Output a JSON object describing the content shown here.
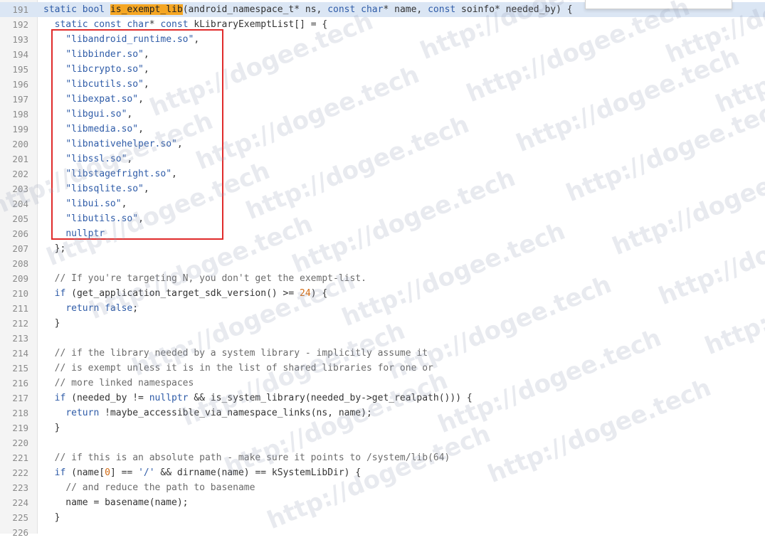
{
  "watermark": "http://dogee.tech",
  "lines": [
    {
      "n": "191",
      "t": [
        [
          "k",
          "static"
        ],
        [
          "p",
          " "
        ],
        [
          "k",
          "bool"
        ],
        [
          "p",
          " "
        ],
        [
          "hl",
          "is_exempt_lib"
        ],
        [
          "p",
          "(android_namespace_t* ns, "
        ],
        [
          "k",
          "const"
        ],
        [
          "p",
          " "
        ],
        [
          "k",
          "char"
        ],
        [
          "p",
          "* name, "
        ],
        [
          "k",
          "const"
        ],
        [
          "p",
          " soinfo* needed_by) {"
        ]
      ]
    },
    {
      "n": "192",
      "t": [
        [
          "p",
          "  "
        ],
        [
          "k",
          "static"
        ],
        [
          "p",
          " "
        ],
        [
          "k",
          "const"
        ],
        [
          "p",
          " "
        ],
        [
          "k",
          "char"
        ],
        [
          "p",
          "* "
        ],
        [
          "k",
          "const"
        ],
        [
          "p",
          " kLibraryExemptList[] = {"
        ]
      ]
    },
    {
      "n": "193",
      "t": [
        [
          "p",
          "    "
        ],
        [
          "s",
          "\"libandroid_runtime.so\""
        ],
        [
          "p",
          ","
        ]
      ]
    },
    {
      "n": "194",
      "t": [
        [
          "p",
          "    "
        ],
        [
          "s",
          "\"libbinder.so\""
        ],
        [
          "p",
          ","
        ]
      ]
    },
    {
      "n": "195",
      "t": [
        [
          "p",
          "    "
        ],
        [
          "s",
          "\"libcrypto.so\""
        ],
        [
          "p",
          ","
        ]
      ]
    },
    {
      "n": "196",
      "t": [
        [
          "p",
          "    "
        ],
        [
          "s",
          "\"libcutils.so\""
        ],
        [
          "p",
          ","
        ]
      ]
    },
    {
      "n": "197",
      "t": [
        [
          "p",
          "    "
        ],
        [
          "s",
          "\"libexpat.so\""
        ],
        [
          "p",
          ","
        ]
      ]
    },
    {
      "n": "198",
      "t": [
        [
          "p",
          "    "
        ],
        [
          "s",
          "\"libgui.so\""
        ],
        [
          "p",
          ","
        ]
      ]
    },
    {
      "n": "199",
      "t": [
        [
          "p",
          "    "
        ],
        [
          "s",
          "\"libmedia.so\""
        ],
        [
          "p",
          ","
        ]
      ]
    },
    {
      "n": "200",
      "t": [
        [
          "p",
          "    "
        ],
        [
          "s",
          "\"libnativehelper.so\""
        ],
        [
          "p",
          ","
        ]
      ]
    },
    {
      "n": "201",
      "t": [
        [
          "p",
          "    "
        ],
        [
          "s",
          "\"libssl.so\""
        ],
        [
          "p",
          ","
        ]
      ]
    },
    {
      "n": "202",
      "t": [
        [
          "p",
          "    "
        ],
        [
          "s",
          "\"libstagefright.so\""
        ],
        [
          "p",
          ","
        ]
      ]
    },
    {
      "n": "203",
      "t": [
        [
          "p",
          "    "
        ],
        [
          "s",
          "\"libsqlite.so\""
        ],
        [
          "p",
          ","
        ]
      ]
    },
    {
      "n": "204",
      "t": [
        [
          "p",
          "    "
        ],
        [
          "s",
          "\"libui.so\""
        ],
        [
          "p",
          ","
        ]
      ]
    },
    {
      "n": "205",
      "t": [
        [
          "p",
          "    "
        ],
        [
          "s",
          "\"libutils.so\""
        ],
        [
          "p",
          ","
        ]
      ]
    },
    {
      "n": "206",
      "t": [
        [
          "p",
          "    "
        ],
        [
          "k",
          "nullptr"
        ]
      ]
    },
    {
      "n": "207",
      "t": [
        [
          "p",
          "  };"
        ]
      ]
    },
    {
      "n": "208",
      "t": []
    },
    {
      "n": "209",
      "t": [
        [
          "p",
          "  "
        ],
        [
          "c",
          "// If you're targeting N, you don't get the exempt-list."
        ]
      ]
    },
    {
      "n": "210",
      "t": [
        [
          "p",
          "  "
        ],
        [
          "k",
          "if"
        ],
        [
          "p",
          " (get_application_target_sdk_version() >= "
        ],
        [
          "n",
          "24"
        ],
        [
          "p",
          ") {"
        ]
      ]
    },
    {
      "n": "211",
      "t": [
        [
          "p",
          "    "
        ],
        [
          "k",
          "return"
        ],
        [
          "p",
          " "
        ],
        [
          "k",
          "false"
        ],
        [
          "p",
          ";"
        ]
      ]
    },
    {
      "n": "212",
      "t": [
        [
          "p",
          "  }"
        ]
      ]
    },
    {
      "n": "213",
      "t": []
    },
    {
      "n": "214",
      "t": [
        [
          "p",
          "  "
        ],
        [
          "c",
          "// if the library needed by a system library - implicitly assume it"
        ]
      ]
    },
    {
      "n": "215",
      "t": [
        [
          "p",
          "  "
        ],
        [
          "c",
          "// is exempt unless it is in the list of shared libraries for one or"
        ]
      ]
    },
    {
      "n": "216",
      "t": [
        [
          "p",
          "  "
        ],
        [
          "c",
          "// more linked namespaces"
        ]
      ]
    },
    {
      "n": "217",
      "t": [
        [
          "p",
          "  "
        ],
        [
          "k",
          "if"
        ],
        [
          "p",
          " (needed_by != "
        ],
        [
          "k",
          "nullptr"
        ],
        [
          "p",
          " && is_system_library(needed_by->get_realpath())) {"
        ]
      ]
    },
    {
      "n": "218",
      "t": [
        [
          "p",
          "    "
        ],
        [
          "k",
          "return"
        ],
        [
          "p",
          " !maybe_accessible_via_namespace_links(ns, name);"
        ]
      ]
    },
    {
      "n": "219",
      "t": [
        [
          "p",
          "  }"
        ]
      ]
    },
    {
      "n": "220",
      "t": []
    },
    {
      "n": "221",
      "t": [
        [
          "p",
          "  "
        ],
        [
          "c",
          "// if this is an absolute path - make sure it points to /system/lib(64)"
        ]
      ]
    },
    {
      "n": "222",
      "t": [
        [
          "p",
          "  "
        ],
        [
          "k",
          "if"
        ],
        [
          "p",
          " (name["
        ],
        [
          "n",
          "0"
        ],
        [
          "p",
          "] == "
        ],
        [
          "s",
          "'/'"
        ],
        [
          "p",
          " && dirname(name) == kSystemLibDir) {"
        ]
      ]
    },
    {
      "n": "223",
      "t": [
        [
          "p",
          "    "
        ],
        [
          "c",
          "// and reduce the path to basename"
        ]
      ]
    },
    {
      "n": "224",
      "t": [
        [
          "p",
          "    name = basename(name);"
        ]
      ]
    },
    {
      "n": "225",
      "t": [
        [
          "p",
          "  }"
        ]
      ]
    },
    {
      "n": "226",
      "t": []
    }
  ]
}
